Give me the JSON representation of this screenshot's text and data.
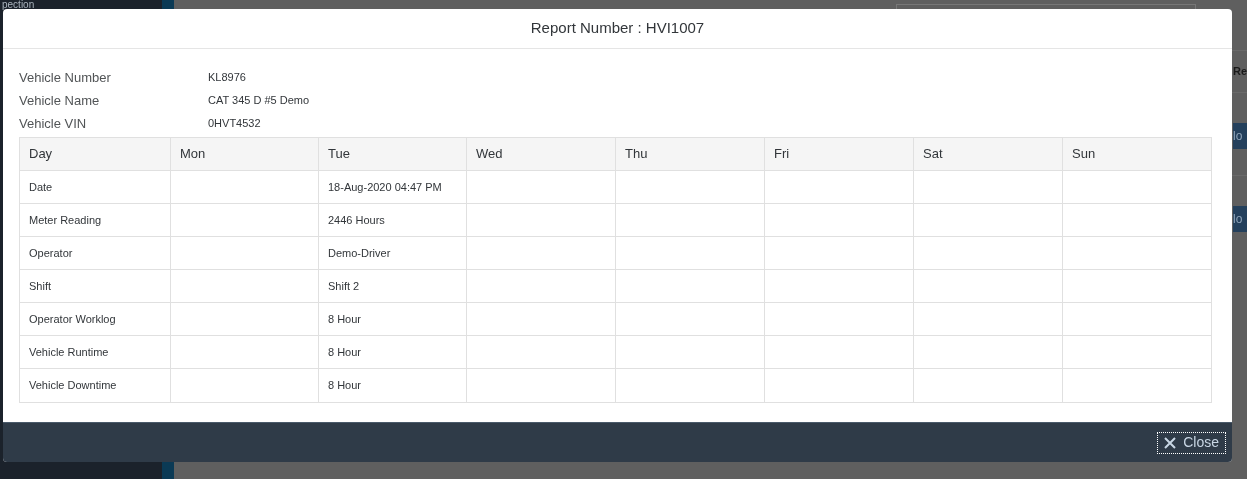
{
  "background": {
    "sidebar_title": "pection",
    "column_header": "Re",
    "row_buttons": [
      "lo",
      "lo"
    ]
  },
  "dialog": {
    "title": "Report Number : HVI1007",
    "fields": [
      {
        "label": "Vehicle Number",
        "value": "KL8976"
      },
      {
        "label": "Vehicle Name",
        "value": "CAT 345 D #5 Demo"
      },
      {
        "label": "Vehicle VIN",
        "value": "0HVT4532"
      }
    ],
    "table": {
      "columns": [
        "Day",
        "Mon",
        "Tue",
        "Wed",
        "Thu",
        "Fri",
        "Sat",
        "Sun"
      ],
      "rows": [
        {
          "label": "Date",
          "cells": [
            null,
            "18-Aug-2020 04:47 PM",
            null,
            null,
            null,
            null,
            null
          ]
        },
        {
          "label": "Meter Reading",
          "cells": [
            null,
            "2446 Hours",
            null,
            null,
            null,
            null,
            null
          ]
        },
        {
          "label": "Operator",
          "cells": [
            null,
            "Demo-Driver",
            null,
            null,
            null,
            null,
            null
          ]
        },
        {
          "label": "Shift",
          "cells": [
            null,
            "Shift 2",
            null,
            null,
            null,
            null,
            null
          ]
        },
        {
          "label": "Operator Worklog",
          "cells": [
            null,
            "8 Hour",
            null,
            null,
            null,
            null,
            null
          ]
        },
        {
          "label": "Vehicle Runtime",
          "cells": [
            null,
            "8 Hour",
            null,
            null,
            null,
            null,
            null
          ]
        },
        {
          "label": "Vehicle Downtime",
          "cells": [
            null,
            "8 Hour",
            null,
            null,
            null,
            null,
            null
          ]
        }
      ]
    },
    "close_button": "Close"
  }
}
